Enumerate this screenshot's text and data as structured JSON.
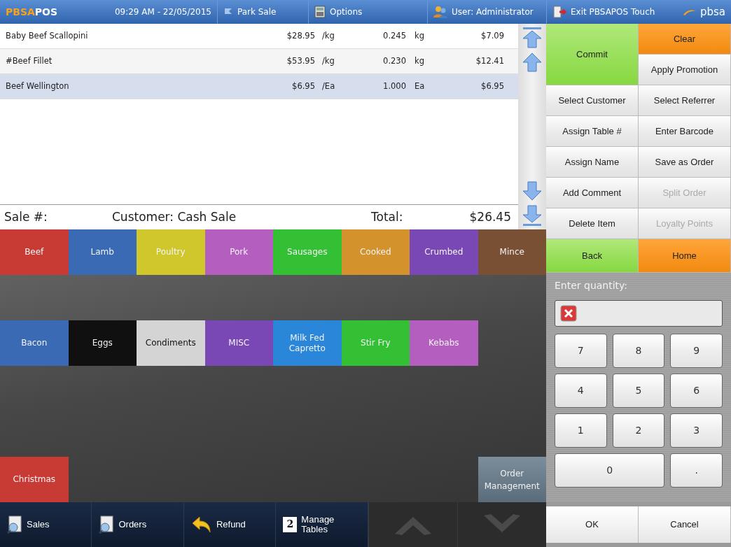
{
  "top_bar": {
    "logo_first": "PBSA",
    "logo_second": "POS",
    "datetime": "09:29 AM - 22/05/2015",
    "park_sale": "Park Sale",
    "options": "Options",
    "user": "User: Administrator",
    "exit": "Exit PBSAPOS Touch",
    "brand": "pbsa"
  },
  "order_lines": [
    {
      "name": "Baby Beef Scallopini",
      "price": "$28.95",
      "per": "/kg",
      "qty": "0.245",
      "unit": "kg",
      "total": "$7.09",
      "selected": false
    },
    {
      "name": "#Beef Fillet",
      "price": "$53.95",
      "per": "/kg",
      "qty": "0.230",
      "unit": "kg",
      "total": "$12.41",
      "selected": false
    },
    {
      "name": "Beef Wellington",
      "price": "$6.95",
      "per": "/Ea",
      "qty": "1.000",
      "unit": "Ea",
      "total": "$6.95",
      "selected": true
    }
  ],
  "sale_summary": {
    "sale_no": "Sale #:",
    "customer": "Customer: Cash Sale",
    "total_label": "Total:",
    "total": "$26.45"
  },
  "category_rows": [
    [
      {
        "label": "Beef",
        "color": "#c83a34"
      },
      {
        "label": "Lamb",
        "color": "#3a6ab4"
      },
      {
        "label": "Poultry",
        "color": "#cfc72c"
      },
      {
        "label": "Pork",
        "color": "#b45ec0"
      },
      {
        "label": "Sausages",
        "color": "#34c034"
      },
      {
        "label": "Cooked",
        "color": "#d4922c"
      },
      {
        "label": "Crumbed",
        "color": "#7a48b4"
      },
      {
        "label": "Mince",
        "color": "#7a5034"
      }
    ],
    [
      {
        "label": "Bacon",
        "color": "#3a6ab4"
      },
      {
        "label": "Eggs",
        "color": "#101010"
      },
      {
        "label": "Condiments",
        "color": "#d4d4d4"
      },
      {
        "label": "MISC",
        "color": "#7a48b4"
      },
      {
        "label": "Milk Fed Capretto",
        "color": "#2a86d8"
      },
      {
        "label": "Stir Fry",
        "color": "#34c034"
      },
      {
        "label": "Kebabs",
        "color": "#b45ec0"
      }
    ],
    [
      {
        "label": "Christmas",
        "color": "#c83a34"
      }
    ]
  ],
  "order_management": "Order Management",
  "bottom_bar": [
    {
      "label": "Sales",
      "kind": "search"
    },
    {
      "label": "Orders",
      "kind": "search"
    },
    {
      "label": "Refund",
      "kind": "undo"
    },
    {
      "label": "Manage Tables",
      "kind": "count",
      "badge": "2"
    }
  ],
  "commit_button": {
    "label": "Commit",
    "kind": "go"
  },
  "quick_actions": [
    {
      "label": "Clear",
      "kind": "warn"
    },
    {
      "label": "Apply Promotion",
      "kind": "plain"
    }
  ],
  "actions": [
    {
      "label": "Select Customer",
      "kind": "plain",
      "disabled": false
    },
    {
      "label": "Select Referrer",
      "kind": "plain",
      "disabled": false
    },
    {
      "label": "Assign Table #",
      "kind": "plain",
      "disabled": false
    },
    {
      "label": "Enter Barcode",
      "kind": "plain",
      "disabled": false
    },
    {
      "label": "Assign Name",
      "kind": "plain",
      "disabled": false
    },
    {
      "label": "Save as Order",
      "kind": "plain",
      "disabled": false
    },
    {
      "label": "Add Comment",
      "kind": "plain",
      "disabled": false
    },
    {
      "label": "Split Order",
      "kind": "plain",
      "disabled": true
    },
    {
      "label": "Delete Item",
      "kind": "plain",
      "disabled": false
    },
    {
      "label": "Loyalty Points",
      "kind": "plain",
      "disabled": true
    },
    {
      "label": "Back",
      "kind": "go",
      "disabled": false
    },
    {
      "label": "Home",
      "kind": "warn",
      "disabled": false
    }
  ],
  "keypad": {
    "prompt": "Enter quantity:",
    "keys": [
      "7",
      "8",
      "9",
      "4",
      "5",
      "6",
      "1",
      "2",
      "3",
      "0",
      "."
    ]
  },
  "dialog_buttons": [
    "OK",
    "Cancel"
  ]
}
